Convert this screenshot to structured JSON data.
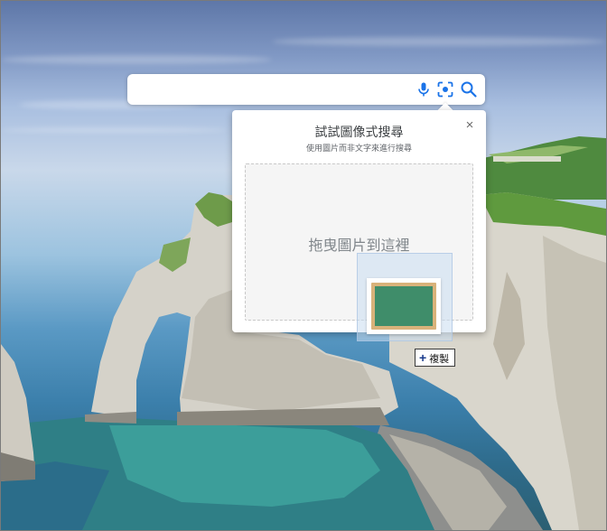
{
  "search": {
    "value": "",
    "placeholder": "",
    "icons": [
      "mic-icon",
      "camera-lens-icon",
      "search-icon"
    ]
  },
  "image_search_popup": {
    "title": "試試圖像式搜尋",
    "subtitle": "使用圖片而非文字來進行搜尋",
    "close_label": "×",
    "drop_zone_text": "拖曳圖片到這裡"
  },
  "drag": {
    "thumbnail": "chalkboard-image",
    "tooltip_plus": "+",
    "tooltip_label": "複製"
  },
  "colors": {
    "accent_blue": "#1a73e8",
    "chalkboard_green": "#3f8d6a",
    "chalkboard_frame": "#d8b27a"
  }
}
